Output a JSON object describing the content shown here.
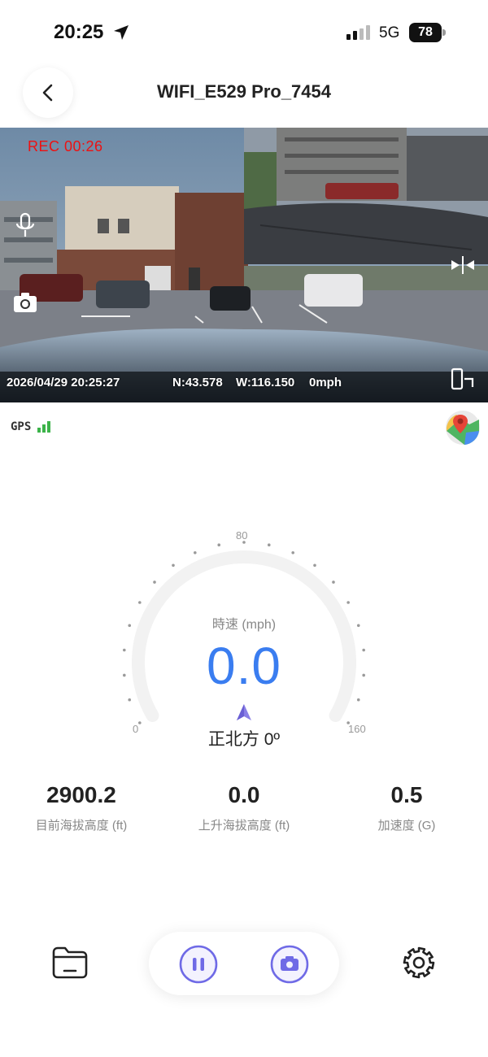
{
  "status_bar": {
    "time": "20:25",
    "network": "5G",
    "battery": "78"
  },
  "header": {
    "title": "WIFI_E529 Pro_7454"
  },
  "video": {
    "rec_label": "REC  00:26",
    "datetime": "2026/04/29  20:25:27",
    "latitude": "N:43.578",
    "longitude": "W:116.150",
    "speed_overlay": "0mph"
  },
  "gps": {
    "label": "GPS"
  },
  "gauge": {
    "speed_label": "時速 (mph)",
    "speed_value": "0.0",
    "heading": "正北方 0º",
    "tick_min": "0",
    "tick_mid": "80",
    "tick_max": "160"
  },
  "stats": [
    {
      "value": "2900.2",
      "label": "目前海拔高度 (ft)"
    },
    {
      "value": "0.0",
      "label": "上升海拔高度 (ft)"
    },
    {
      "value": "0.5",
      "label": "加速度 (G)"
    }
  ],
  "colors": {
    "accent": "#3a7df0",
    "rec": "#e11111",
    "button_purple": "#6f6ae6"
  }
}
